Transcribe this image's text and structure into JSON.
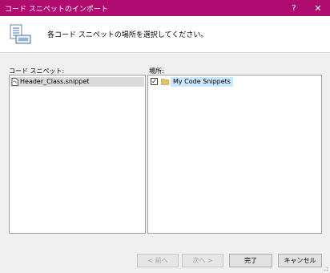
{
  "window": {
    "title": "コード スニペットのインポート",
    "help_icon": "?",
    "close_icon": "✕"
  },
  "header": {
    "instruction": "各コード スニペットの場所を選択してください。",
    "icon": "snippet-import-icon"
  },
  "snippets": {
    "label": "コード スニペット:",
    "items": [
      {
        "name": "Header_Class.snippet",
        "icon": "snippet-file-icon",
        "selected": true
      }
    ]
  },
  "locations": {
    "label": "場所:",
    "items": [
      {
        "name": "My Code Snippets",
        "checked": true,
        "icon": "folder-icon",
        "check_glyph": "✓"
      }
    ]
  },
  "buttons": {
    "prev": "< 前へ",
    "next": "次へ >",
    "finish": "完了",
    "cancel": "キャンセル"
  },
  "colors": {
    "titlebar": "#b00b6e",
    "selection": "#cce8ff",
    "folder": "#e8c064"
  }
}
